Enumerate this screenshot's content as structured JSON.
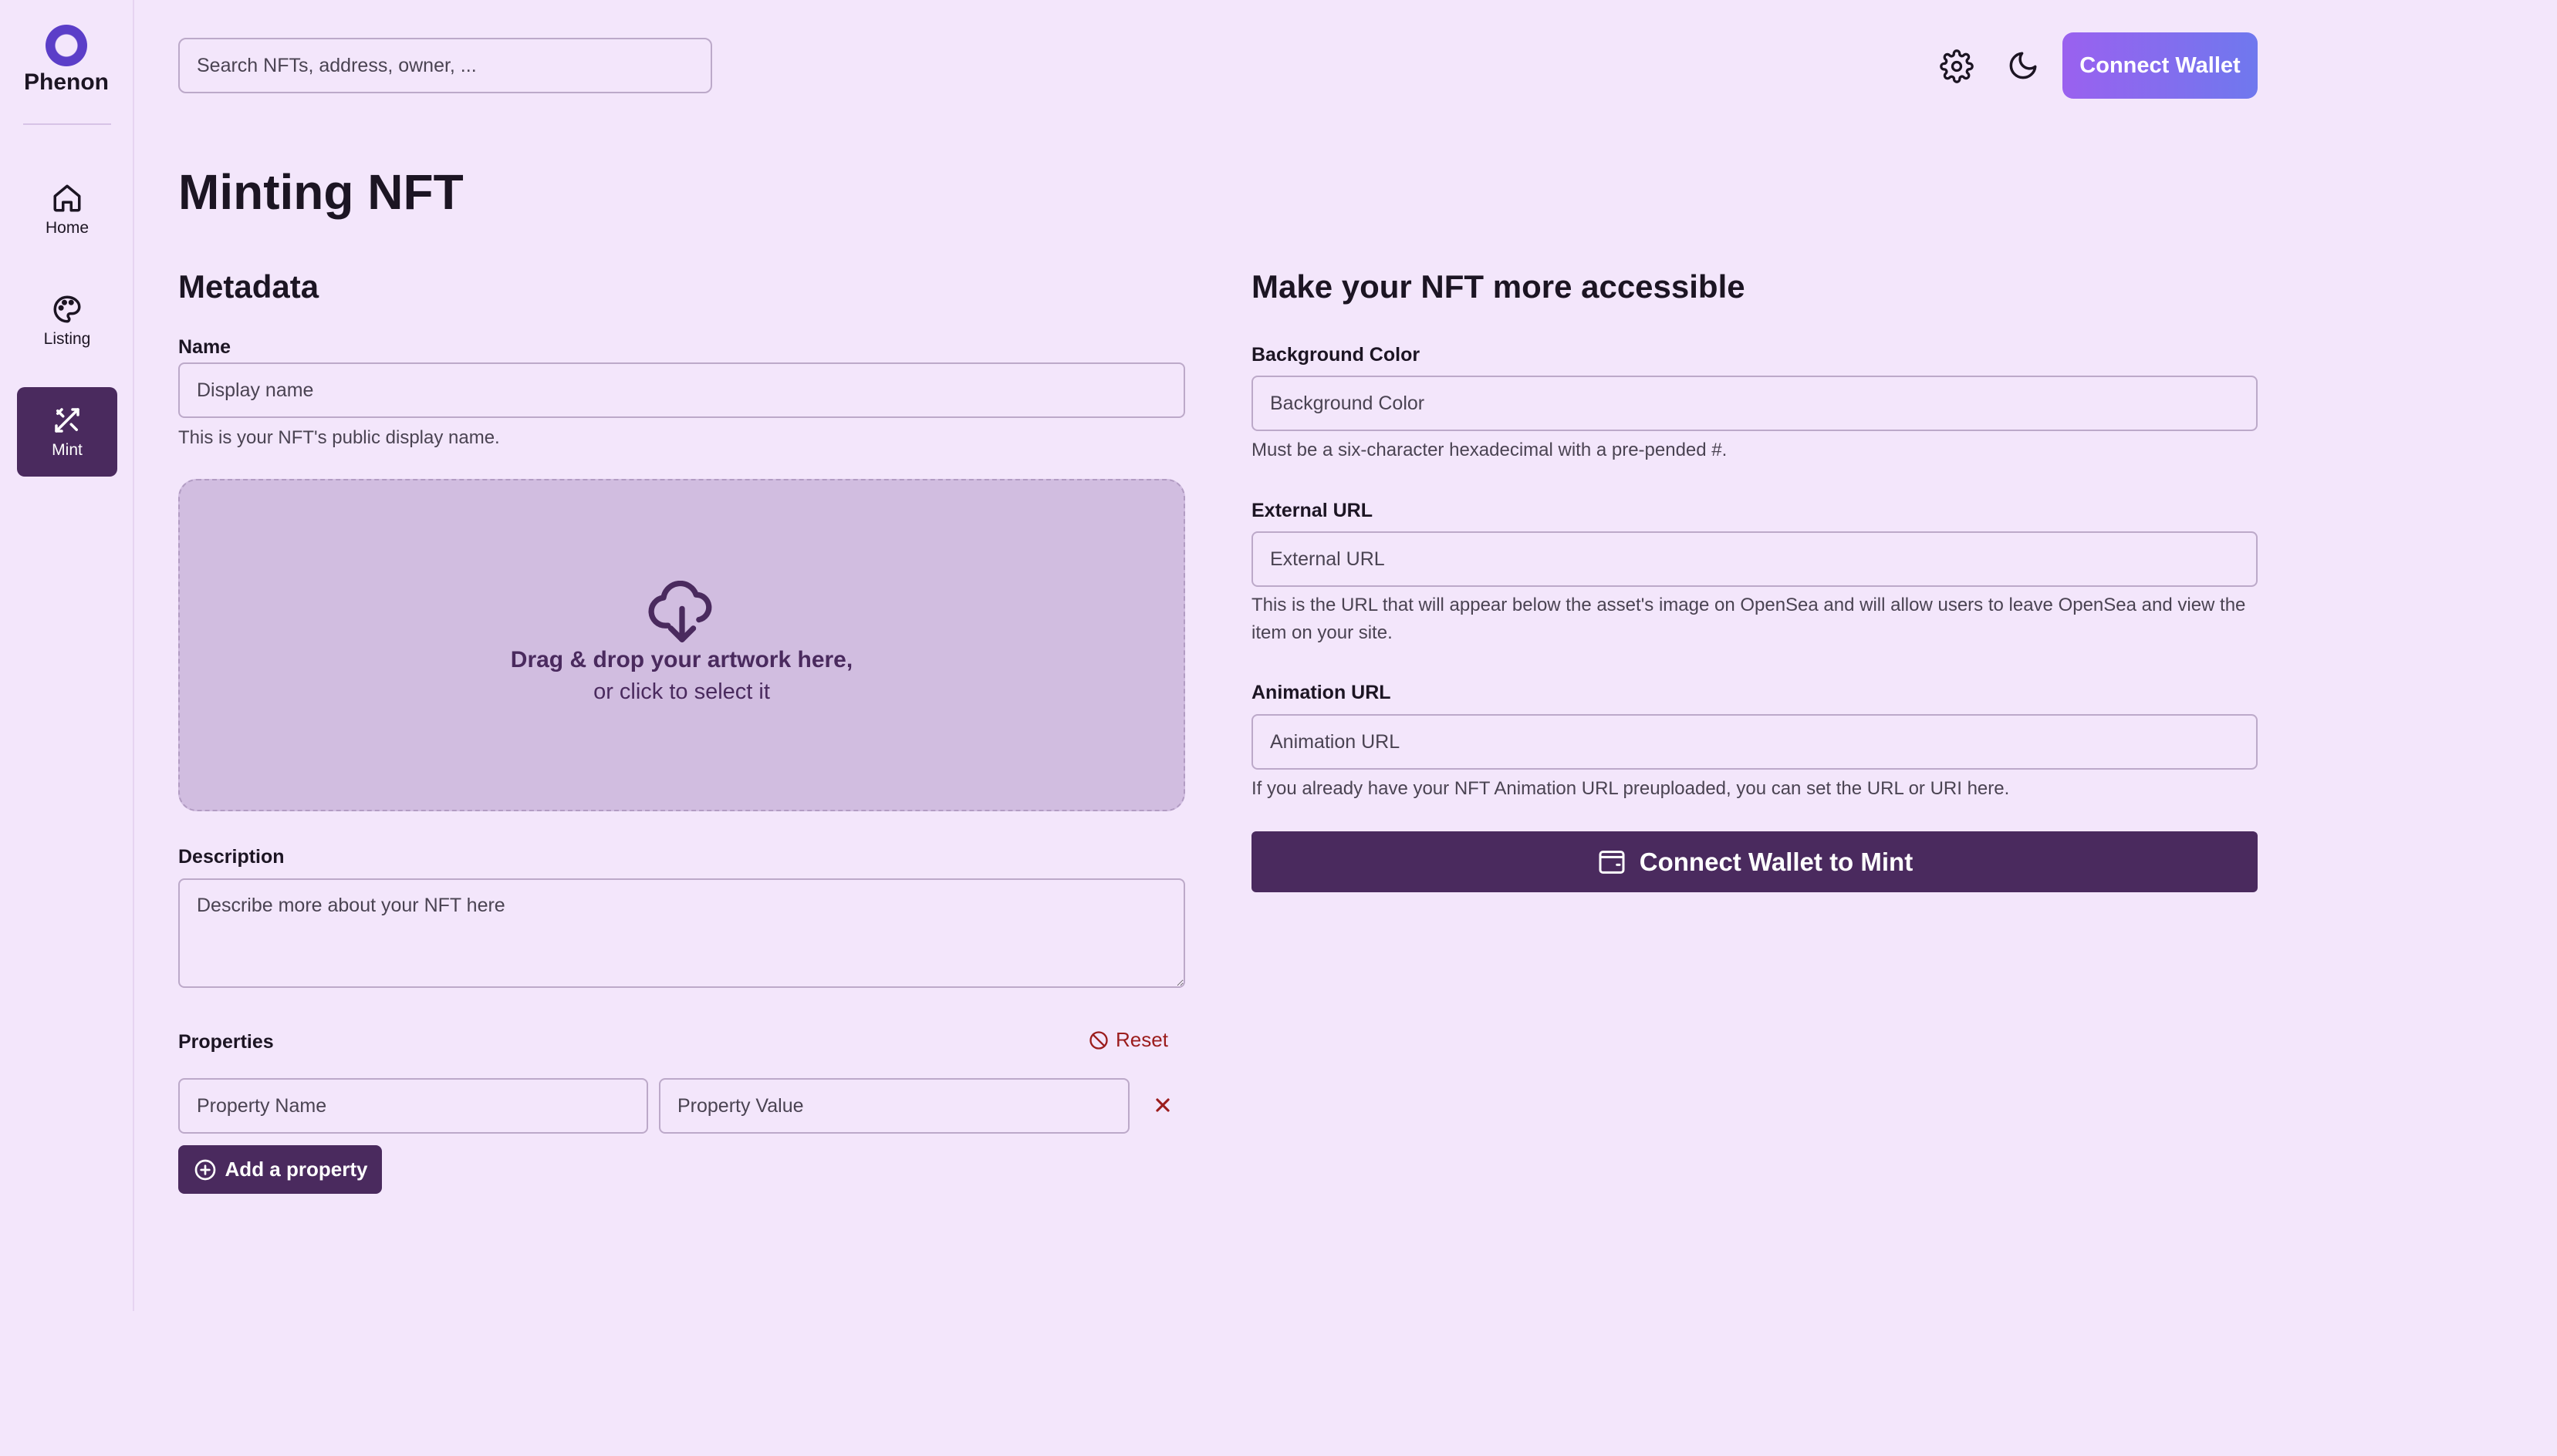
{
  "brand": {
    "name": "Phenon"
  },
  "sidebar": {
    "items": [
      {
        "label": "Home",
        "icon": "home-icon"
      },
      {
        "label": "Listing",
        "icon": "palette-icon"
      },
      {
        "label": "Mint",
        "icon": "mint-icon",
        "active": true
      }
    ]
  },
  "header": {
    "search_placeholder": "Search NFTs, address, owner, ...",
    "connect_label": "Connect Wallet"
  },
  "page": {
    "title": "Minting NFT"
  },
  "metadata": {
    "title": "Metadata",
    "name_label": "Name",
    "name_placeholder": "Display name",
    "name_help": "This is your NFT's public display name.",
    "dropzone_main": "Drag & drop your artwork here,",
    "dropzone_sub": "or click to select it",
    "description_label": "Description",
    "description_placeholder": "Describe more about your NFT here",
    "properties_label": "Properties",
    "reset_label": "Reset",
    "property_name_placeholder": "Property Name",
    "property_value_placeholder": "Property Value",
    "add_property_label": "Add a property"
  },
  "accessible": {
    "title": "Make your NFT more accessible",
    "bg_label": "Background Color",
    "bg_placeholder": "Background Color",
    "bg_help": "Must be a six-character hexadecimal with a pre-pended #.",
    "ext_label": "External URL",
    "ext_placeholder": "External URL",
    "ext_help": "This is the URL that will appear below the asset's image on OpenSea and will allow users to leave OpenSea and view the item on your site.",
    "anim_label": "Animation URL",
    "anim_placeholder": "Animation URL",
    "anim_help": "If you already have your NFT Animation URL preuploaded, you can set the URL or URI here.",
    "mint_label": "Connect Wallet to Mint"
  },
  "colors": {
    "background": "#f3e6fb",
    "primary": "#4a2a5e",
    "danger": "#9b1c1c",
    "gradient_start": "#9a61ef",
    "gradient_end": "#6f78ee"
  }
}
